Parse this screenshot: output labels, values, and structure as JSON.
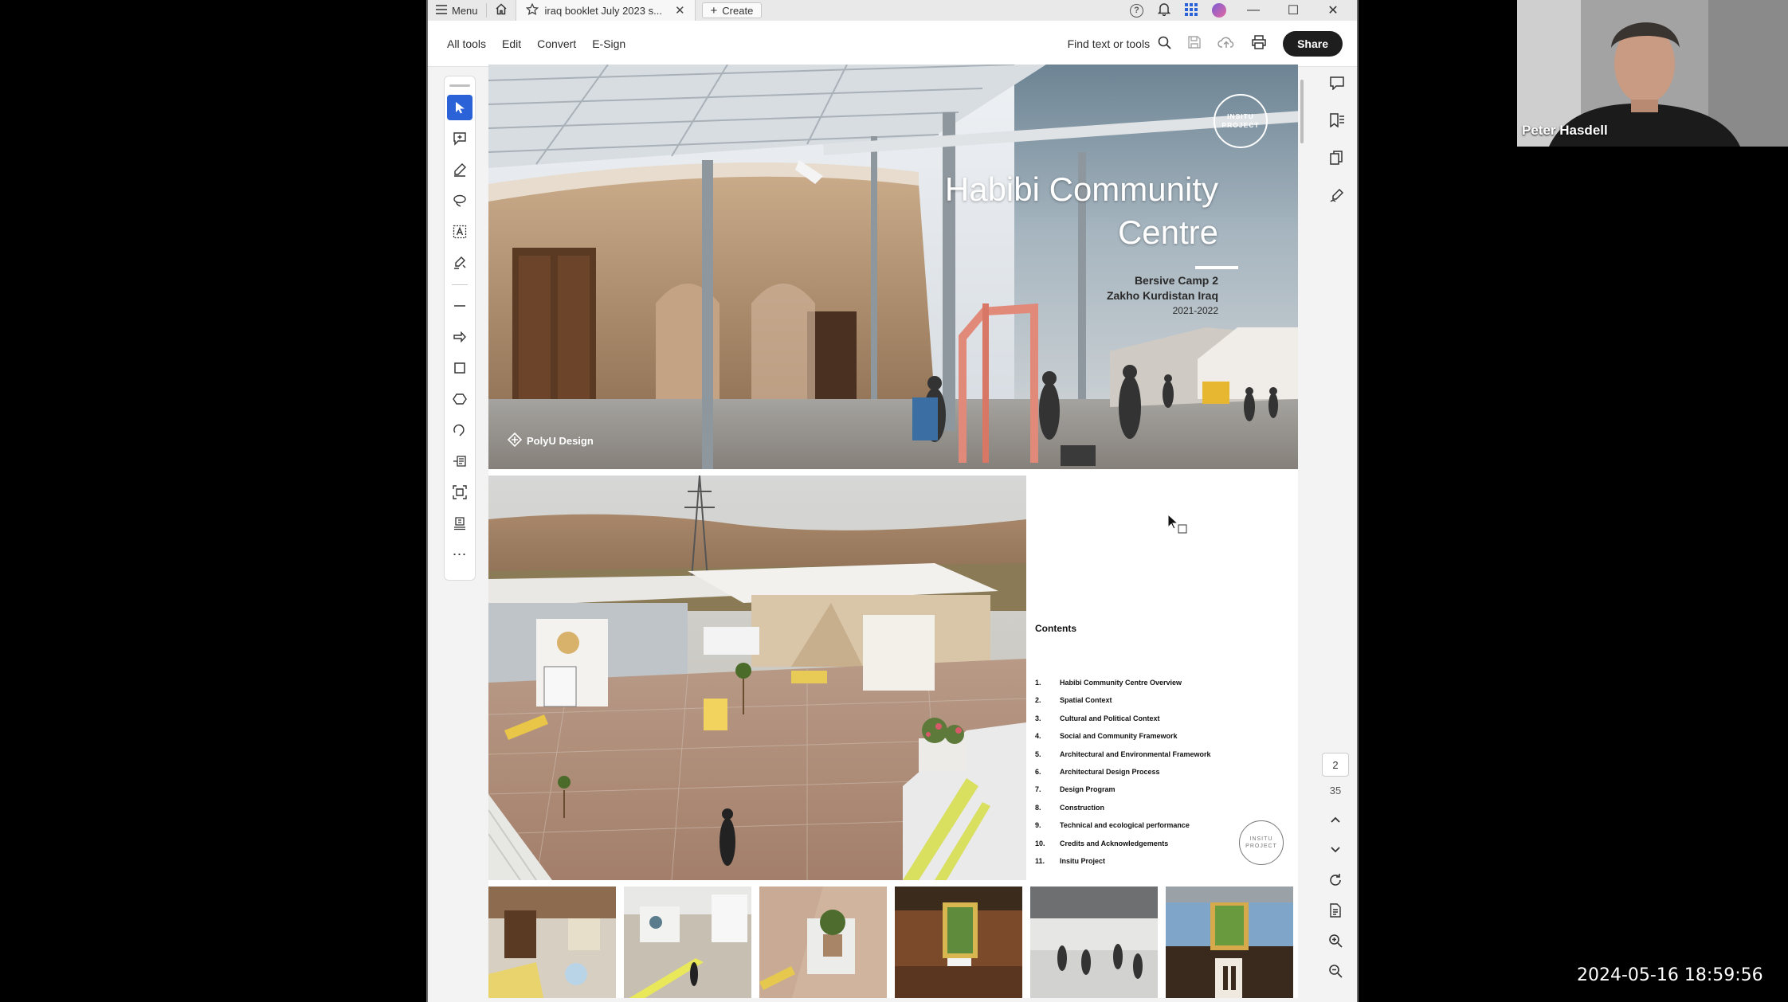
{
  "titlebar": {
    "menu_label": "Menu",
    "tab_title": "iraq booklet July 2023  s...",
    "create_label": "Create",
    "help_icon": "?"
  },
  "menubar": {
    "items": [
      "All tools",
      "Edit",
      "Convert",
      "E-Sign"
    ],
    "find_label": "Find text or tools",
    "share_label": "Share"
  },
  "cover": {
    "title_line1": "Habibi Community",
    "title_line2": "Centre",
    "sub_line1": "Bersive Camp 2",
    "sub_line2": "Zakho Kurdistan Iraq",
    "years": "2021-2022",
    "logo_line1": "INSITU",
    "logo_line2": "PROJECT",
    "polyu_label": "PolyU Design"
  },
  "contents": {
    "title": "Contents",
    "items": [
      {
        "n": "1.",
        "label": "Habibi Community Centre Overview"
      },
      {
        "n": "2.",
        "label": "Spatial Context"
      },
      {
        "n": "3.",
        "label": "Cultural and Political Context"
      },
      {
        "n": "4.",
        "label": "Social and Community Framework"
      },
      {
        "n": "5.",
        "label": "Architectural and Environmental Framework"
      },
      {
        "n": "6.",
        "label": "Architectural Design Process"
      },
      {
        "n": "7.",
        "label": "Design Program"
      },
      {
        "n": "8.",
        "label": "Construction"
      },
      {
        "n": "9.",
        "label": "Technical and ecological performance"
      },
      {
        "n": "10.",
        "label": "Credits and Acknowledgements"
      },
      {
        "n": "11.",
        "label": "Insitu Project"
      }
    ]
  },
  "page_control": {
    "current_page": "2",
    "total_pages": "35"
  },
  "webcam": {
    "name": "Peter Hasdell"
  },
  "timestamp": "2024-05-16  18:59:56",
  "colors": {
    "accent": "#2c62d8",
    "share_bg": "#1e1e1e"
  }
}
